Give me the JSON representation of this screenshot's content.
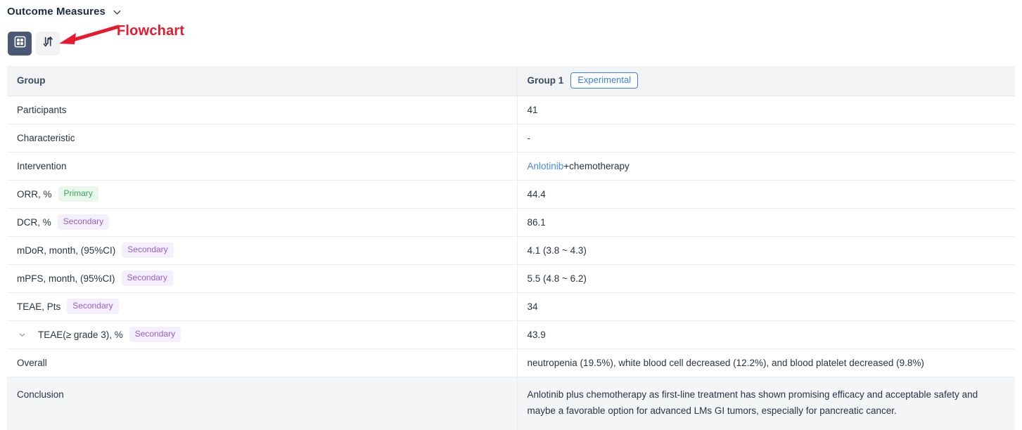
{
  "section": {
    "title": "Outcome Measures",
    "collapse_icon": "chevron-down-icon"
  },
  "view_toggle": {
    "table_view": {
      "icon": "table-grid-icon",
      "state": "active"
    },
    "flowchart_view": {
      "icon": "swap-arrows-icon",
      "state": "inactive"
    }
  },
  "annotation": {
    "label": "Flowchart",
    "color": "#e8192c",
    "arrow": "left-arrow-icon"
  },
  "table": {
    "header": {
      "col1": "Group",
      "col2_title": "Group 1",
      "col2_badge": "Experimental"
    },
    "rows": [
      {
        "label": "Participants",
        "tag": null,
        "value": "41"
      },
      {
        "label": "Characteristic",
        "tag": null,
        "value": "-"
      },
      {
        "label": "Intervention",
        "tag": null,
        "value_link": "Anlotinib",
        "value_rest": "+chemotherapy"
      },
      {
        "label": "ORR, %",
        "tag": "Primary",
        "value": "44.4"
      },
      {
        "label": "DCR, %",
        "tag": "Secondary",
        "value": "86.1"
      },
      {
        "label": "mDoR, month, (95%CI)",
        "tag": "Secondary",
        "value": "4.1 (3.8 ~ 4.3)"
      },
      {
        "label": "mPFS, month, (95%CI)",
        "tag": "Secondary",
        "value": "5.5 (4.8 ~ 6.2)"
      },
      {
        "label": "TEAE, Pts",
        "tag": "Secondary",
        "value": "34"
      },
      {
        "label": "TEAE(≥ grade 3), %",
        "tag": "Secondary",
        "value": "43.9",
        "expandable": true
      },
      {
        "label": "Overall",
        "tag": null,
        "value": "neutropenia (19.5%), white blood cell decreased (12.2%), and blood platelet decreased (9.8%)",
        "indent": 2
      }
    ],
    "conclusion": {
      "label": "Conclusion",
      "text": "Anlotinib plus chemotherapy as first-line treatment has shown promising efficacy and acceptable safety and maybe a favorable option for advanced LMs GI tumors, especially for pancreatic cancer."
    }
  },
  "colors": {
    "accent_blue": "#3d7ff0",
    "link_blue": "#3d8bf2",
    "primary_tag": "#3ba75b",
    "secondary_tag": "#9b5bd6",
    "annotation_red": "#e8192c",
    "toggle_active": "#4a5875"
  }
}
